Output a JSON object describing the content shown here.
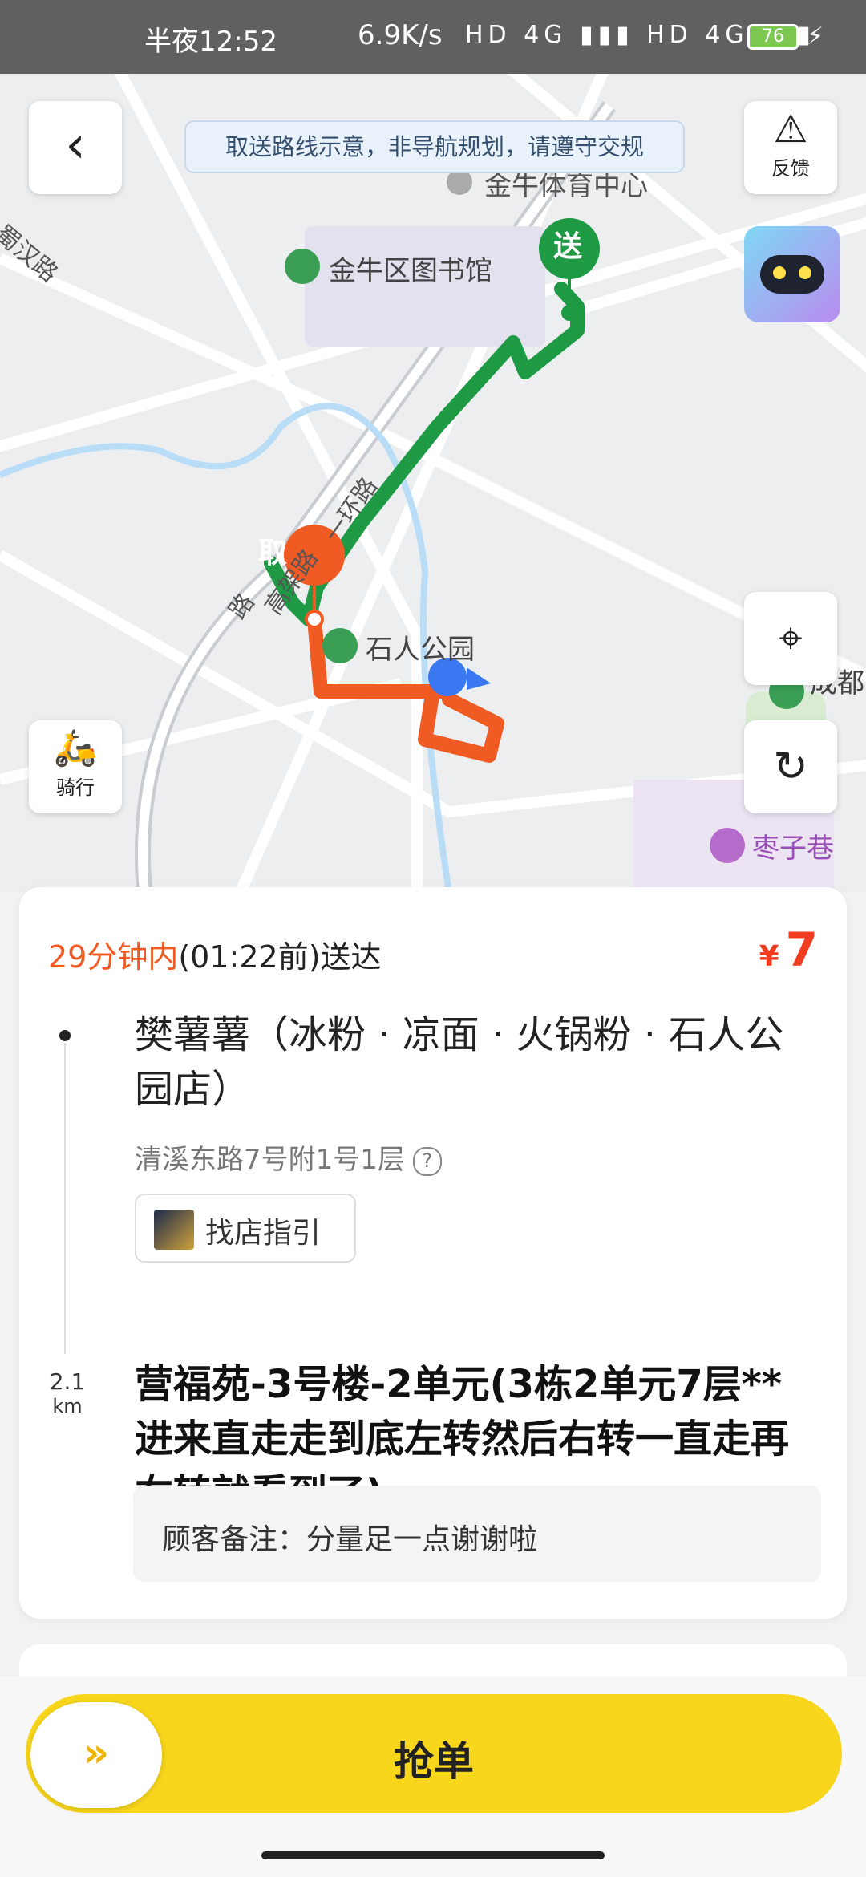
{
  "status_bar": {
    "time": "半夜12:52",
    "network_speed": "6.9K/s",
    "signal_icons": "HD 4G ▮▮▮ HD 4G ▮▮▮",
    "battery": "76"
  },
  "map": {
    "notice": "取送路线示意，非导航规划，请遵守交规",
    "labels": {
      "stadium": "金牛体育中心",
      "library": "金牛区图书馆",
      "park": "石人公园",
      "alley": "枣子巷",
      "city": "成都",
      "road_left": "蜀汉路",
      "road_ring": "一环路",
      "road_viaduct": "高架路",
      "road_bottom": "路"
    },
    "pickup_marker": "取",
    "delivery_marker": "送",
    "feedback_label": "反馈",
    "ride_label": "骑行",
    "colors": {
      "pickup_route": "#f05a23",
      "delivery_route": "#1e9a45",
      "user_dot": "#3a78f2"
    }
  },
  "order": {
    "deliver_highlight": "29分钟内",
    "deliver_rest": "(01:22前)送达",
    "price_symbol": "¥",
    "price": "7",
    "shop_name": "樊薯薯（冰粉 · 凉面 · 火锅粉 · 石人公园店）",
    "shop_address": "清溪东路7号附1号1层",
    "guide_label": "找店指引",
    "distance_value": "2.1",
    "distance_unit": "km",
    "destination": "营福苑-3号楼-2单元(3栋2单元7层**进来直走走到底左转然后右转一直走再右转就看到了)",
    "remark": "顾客备注：分量足一点谢谢啦"
  },
  "action": {
    "grab_label": "抢单",
    "slider_icon": "»"
  },
  "icons": [
    "back-icon",
    "warning-icon",
    "robot-icon",
    "locate-icon",
    "refresh-icon",
    "scooter-icon",
    "question-icon"
  ]
}
